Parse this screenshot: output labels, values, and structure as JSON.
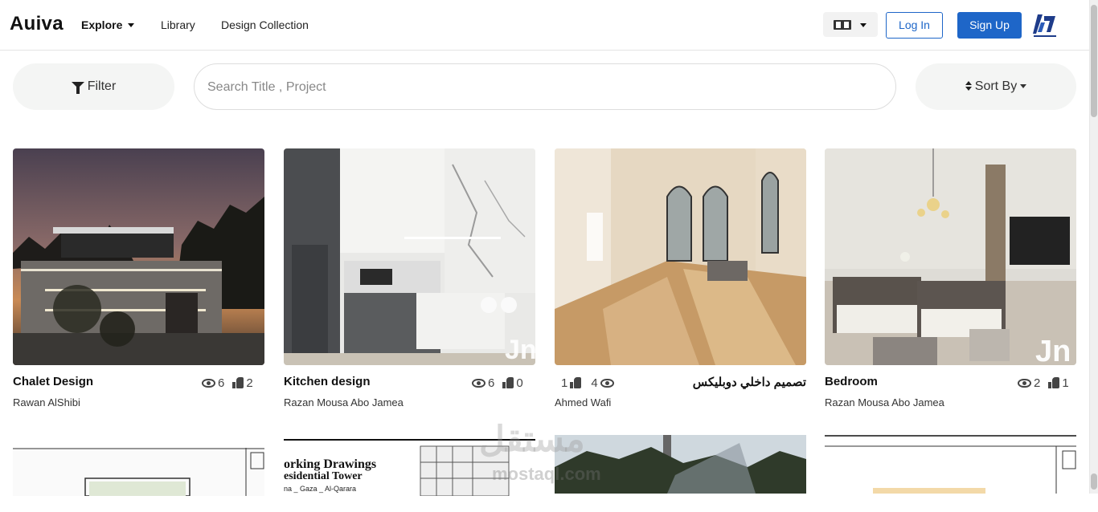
{
  "header": {
    "brand": "Auiva",
    "nav": {
      "explore": "Explore",
      "library": "Library",
      "design_collection": "Design Collection"
    },
    "login": "Log In",
    "signup": "Sign Up"
  },
  "toolbar": {
    "filter": "Filter",
    "search_placeholder": "Search Title , Project",
    "sort": "Sort By"
  },
  "projects": [
    {
      "title": "Chalet Design",
      "author": "Rawan AlShibi",
      "views": "6",
      "likes": "2"
    },
    {
      "title": "Kitchen design",
      "author": "Razan Mousa Abo Jamea",
      "views": "6",
      "likes": "0"
    },
    {
      "title": "تصميم داخلي دوبليكس",
      "author": "Ahmed Wafi",
      "views": "4",
      "likes": "1"
    },
    {
      "title": "Bedroom",
      "author": "Razan Mousa Abo Jamea",
      "views": "2",
      "likes": "1"
    }
  ],
  "row2": {
    "card2_heading": "orking Drawings",
    "card2_sub": "esidential Tower",
    "card2_small": "na _ Gaza _ Al-Qarara"
  },
  "watermark": {
    "main": "مستقل",
    "sub": "mostaql.com"
  },
  "colors": {
    "primary": "#1e66c8",
    "pill_bg": "#f4f5f4"
  }
}
